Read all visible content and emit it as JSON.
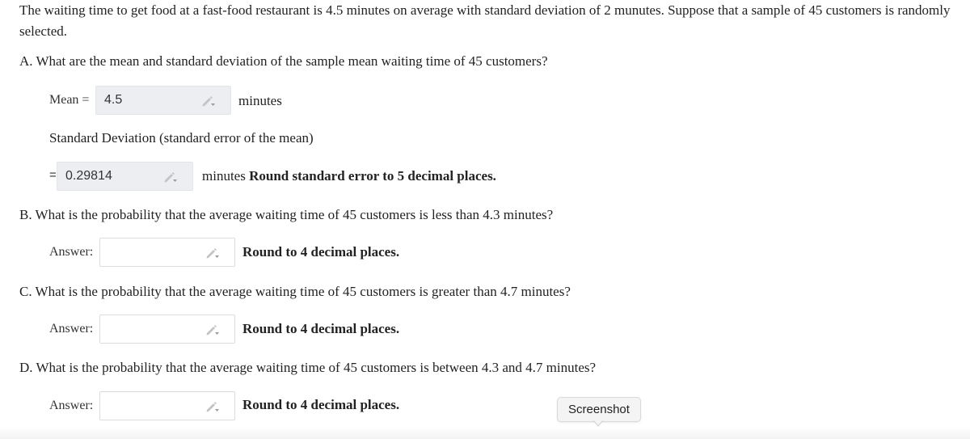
{
  "problem": {
    "intro_text": "The waiting time to get food at a fast-food restaurant is 4.5 minutes on average with standard deviation of 2 munutes. Suppose that a sample of 45 customers is randomly selected."
  },
  "part_a": {
    "question": "A. What are the mean and standard deviation of the sample mean waiting time of 45 customers?",
    "mean_label": "Mean =",
    "mean_value": "4.5",
    "mean_unit": "minutes",
    "sd_label": "Standard Deviation (standard error of the mean)",
    "sd_eq": "=",
    "sd_value": "0.29814",
    "sd_unit": "minutes",
    "sd_instruction": "Round standard error to 5 decimal places."
  },
  "part_b": {
    "question": "B. What is the probability that the average waiting time of 45 customers is less than 4.3 minutes?",
    "answer_label": "Answer:",
    "answer_value": "",
    "instruction": "Round to 4 decimal places."
  },
  "part_c": {
    "question": "C. What is the probability that the average waiting time of 45 customers is greater than 4.7 minutes?",
    "answer_label": "Answer:",
    "answer_value": "",
    "instruction": "Round to 4 decimal places."
  },
  "part_d": {
    "question": "D. What is the probability that the average waiting time of 45 customers is between 4.3 and 4.7 minutes?",
    "answer_label": "Answer:",
    "answer_value": "",
    "instruction": "Round to 4 decimal places."
  },
  "tooltip": {
    "label": "Screenshot"
  },
  "icons": {
    "answer_input_icon": "pencil-dropdown-icon"
  }
}
